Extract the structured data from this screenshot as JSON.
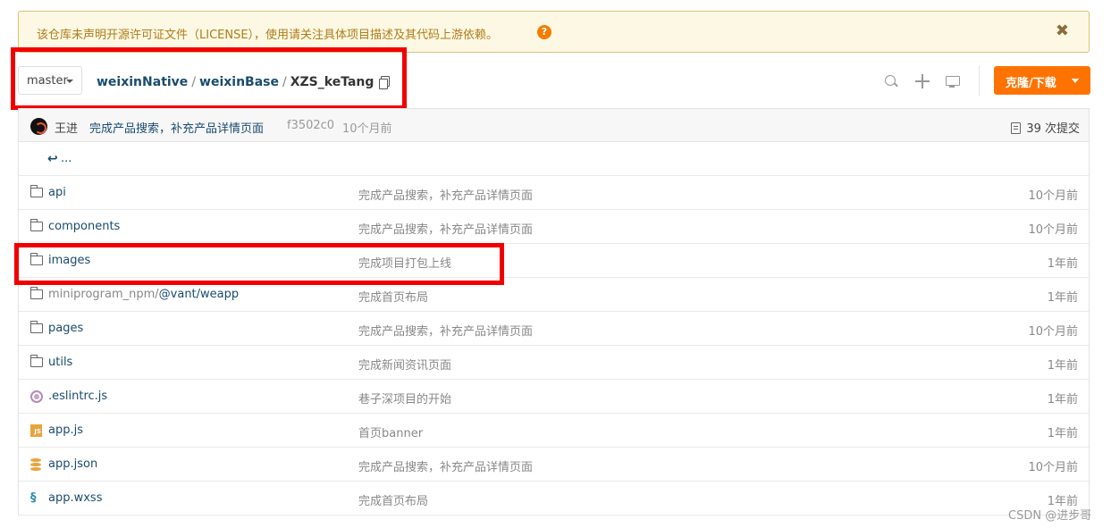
{
  "notice": {
    "text": "该仓库未声明开源许可证文件（LICENSE），使用请关注具体项目描述及其代码上游依赖。",
    "help": "?",
    "close": "✖"
  },
  "toolbar": {
    "branch": "master",
    "breadcrumb": {
      "owner": "weixinNative",
      "repo": "weixinBase",
      "current": "XZS_keTang",
      "sep": "/"
    },
    "clone_label": "克隆/下载"
  },
  "commit": {
    "author": "王进",
    "message": "完成产品搜索，补充产品详情页面",
    "hash": "f3502c0",
    "time": "10个月前",
    "count": "39 次提交"
  },
  "back": {
    "icon": "↩",
    "label": "..."
  },
  "files": [
    {
      "name": "api",
      "message": "完成产品搜索，补充产品详情页面",
      "time": "10个月前",
      "icon": "folder-icon"
    },
    {
      "name": "components",
      "message": "完成产品搜索，补充产品详情页面",
      "time": "10个月前",
      "icon": "folder-icon"
    },
    {
      "name": "images",
      "message": "完成项目打包上线",
      "time": "1年前",
      "icon": "folder-icon"
    },
    {
      "name_prefix": "miniprogram_npm/",
      "name": "@vant/weapp",
      "message": "完成首页布局",
      "time": "1年前",
      "icon": "folder-icon"
    },
    {
      "name": "pages",
      "message": "完成产品搜索，补充产品详情页面",
      "time": "10个月前",
      "icon": "folder-icon"
    },
    {
      "name": "utils",
      "message": "完成新闻资讯页面",
      "time": "1年前",
      "icon": "folder-icon"
    },
    {
      "name": ".eslintrc.js",
      "message": "巷子深项目的开始",
      "time": "1年前",
      "icon": "eslint-icon"
    },
    {
      "name": "app.js",
      "message": "首页banner",
      "time": "1年前",
      "icon": "js-file-icon",
      "badge": "JS"
    },
    {
      "name": "app.json",
      "message": "完成产品搜索，补充产品详情页面",
      "time": "10个月前",
      "icon": "json-file-icon"
    },
    {
      "name": "app.wxss",
      "message": "完成首页布局",
      "time": "1年前",
      "icon": "css-file-icon",
      "glyph": "§"
    }
  ],
  "watermark": "CSDN @进步哥",
  "colors": {
    "accent": "#fe7300",
    "link": "#1a4c6e",
    "highlight_box": "#f20000",
    "notice_bg": "#fcf8e3"
  }
}
